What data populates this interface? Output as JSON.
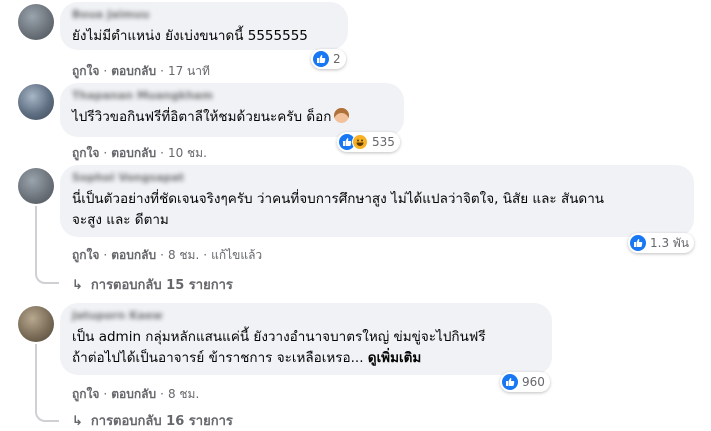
{
  "comments": [
    {
      "text": [
        "ยังไม่มีตำแหน่ง ยังเบ่งขนาดนี้ 5555555"
      ],
      "name": "Boua Jaimuu",
      "actions": {
        "like": "ถูกใจ",
        "reply": "ตอบกลับ",
        "time": "17 นาที"
      },
      "reaction_count": "2"
    },
    {
      "text": [
        "ไปรีวิวขอกินฟรีที่อิตาลีให้ชมด้วยนะครับ ด็อก"
      ],
      "name": "Thapanan Muangkham",
      "actions": {
        "like": "ถูกใจ",
        "reply": "ตอบกลับ",
        "time": "10 ชม."
      },
      "reaction_count": "535"
    },
    {
      "text": [
        "นี่เป็นตัวอย่างที่ชัดเจนจริงๆครับ ว่าคนที่จบการศึกษาสูง ไม่ได้แปลว่าจิตใจ, นิสัย และ สันดาน",
        "จะสูง และ ดีตาม"
      ],
      "name": "Sophol Vongsapat",
      "actions": {
        "like": "ถูกใจ",
        "reply": "ตอบกลับ",
        "time": "8 ชม.",
        "edited": "แก้ไขแล้ว"
      },
      "reaction_count": "1.3 พัน",
      "replies": "การตอบกลับ 15 รายการ"
    },
    {
      "text": [
        "เป็น admin กลุ่มหลักแสนแค่นี้ ยังวางอำนาจบาตรใหญ่ ข่มขู่จะไปกินฟรี",
        "ถ้าต่อไปได้เป็นอาจารย์ ข้าราชการ จะเหลือเหรอ..."
      ],
      "see_more": "ดูเพิ่มเติม",
      "name": "Jatuporn Kaew",
      "actions": {
        "like": "ถูกใจ",
        "reply": "ตอบกลับ",
        "time": "8 ชม."
      },
      "reaction_count": "960",
      "replies": "การตอบกลับ 16 รายการ"
    }
  ],
  "colors": {
    "like": "#1877f2",
    "bubble": "#f0f2f5",
    "meta": "#65676b"
  },
  "icons": {
    "like": "thumbs-up-icon",
    "haha": "haha-icon",
    "reply_arrow": "reply-arrow-icon"
  }
}
